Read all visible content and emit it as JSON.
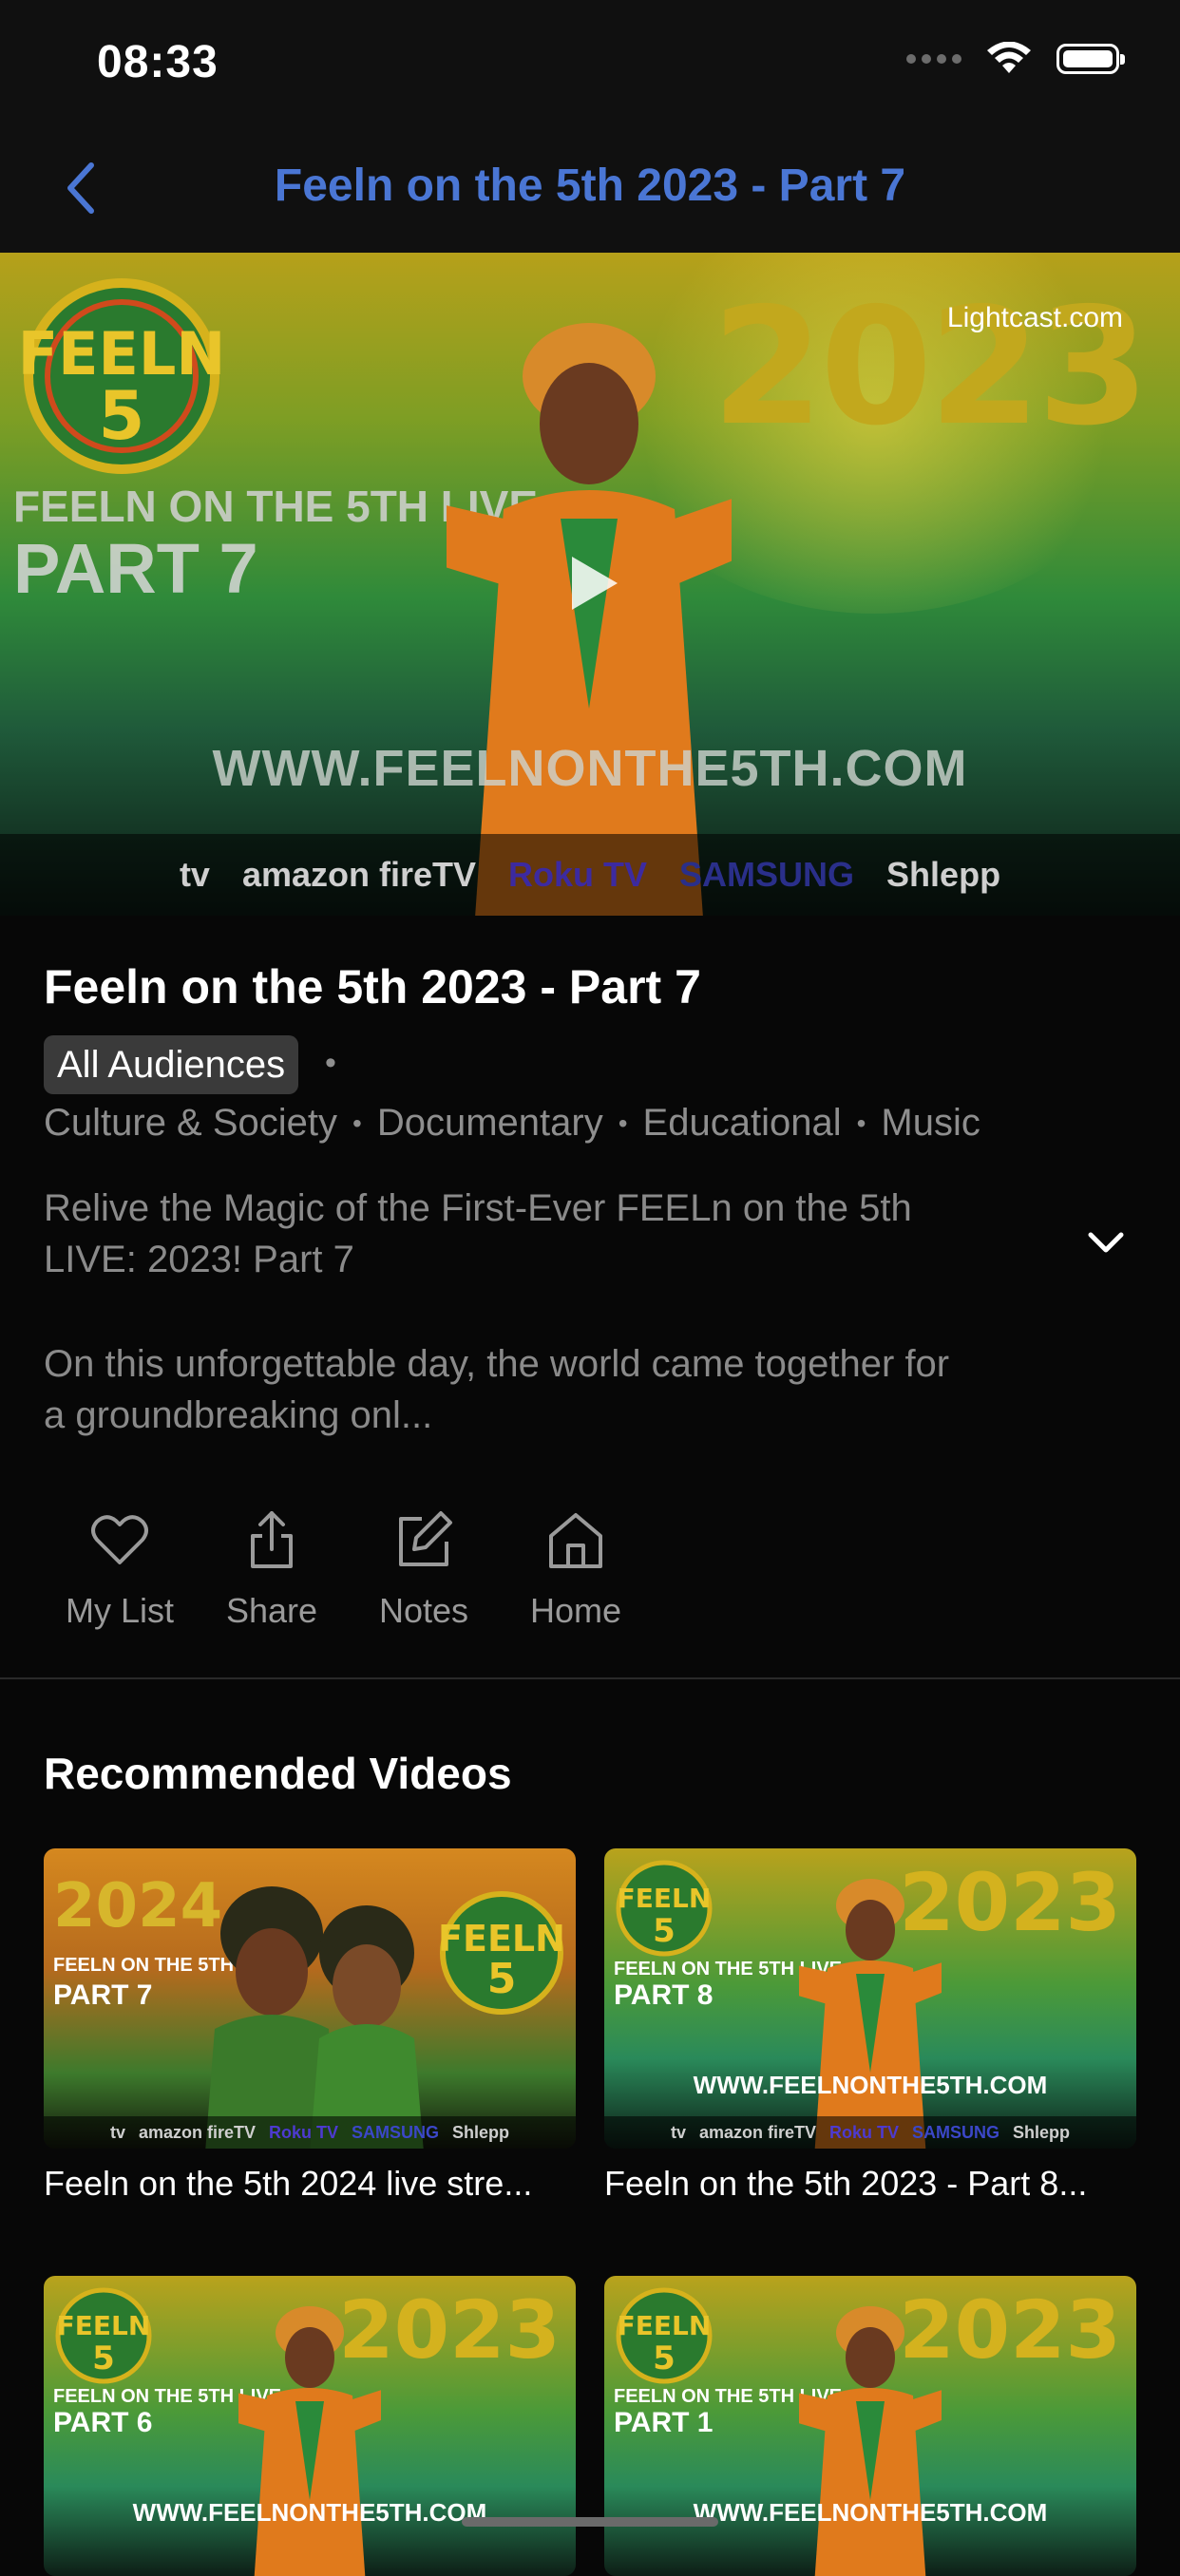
{
  "status_bar": {
    "time": "08:33"
  },
  "nav": {
    "title": "Feeln on the 5th 2023 -  Part 7"
  },
  "hero": {
    "site": "Lightcast.com",
    "year": "2023",
    "tag_line": "FEELN ON THE 5TH LIVE",
    "part": "PART 7",
    "url": "WWW.FEELNONTHE5TH.COM",
    "platforms": [
      "tv",
      "amazon fireTV",
      "Roku TV",
      "SAMSUNG",
      "Shlepp"
    ]
  },
  "video": {
    "title": "Feeln on the 5th 2023 -  Part 7",
    "rating": "All Audiences",
    "rating_dot": "•",
    "genres": [
      "Culture & Society",
      "Documentary",
      "Educational",
      "Music"
    ],
    "genre_sep": "•",
    "description_lines": [
      "Relive the Magic of the First-Ever FEELn on the 5th",
      "LIVE: 2023!  Part 7",
      "On this unforgettable day, the world came together for",
      "a groundbreaking onl..."
    ]
  },
  "actions": [
    {
      "label": "My List",
      "icon": "heart-icon"
    },
    {
      "label": "Share",
      "icon": "share-icon"
    },
    {
      "label": "Notes",
      "icon": "edit-icon"
    },
    {
      "label": "Home",
      "icon": "home-icon"
    }
  ],
  "recommended": {
    "heading": "Recommended Videos",
    "items": [
      {
        "caption": "Feeln on the 5th 2024 live stre...",
        "year": "2024",
        "tag": "FEELN ON THE 5TH LIVE",
        "part": "PART 7",
        "url": "",
        "platforms": [
          "tv",
          "amazon fireTV",
          "Roku TV",
          "SAMSUNG",
          "Shlepp"
        ]
      },
      {
        "caption": "Feeln on the 5th 2023 - Part 8...",
        "year": "2023",
        "tag": "FEELN ON THE 5TH LIVE",
        "part": "PART 8",
        "url": "WWW.FEELNONTHE5TH.COM",
        "platforms": [
          "tv",
          "amazon fireTV",
          "Roku TV",
          "SAMSUNG",
          "Shlepp"
        ]
      },
      {
        "caption": "",
        "year": "2023",
        "tag": "FEELN ON THE 5TH LIVE",
        "part": "PART 6",
        "url": "WWW.FEELNONTHE5TH.COM",
        "platforms": []
      },
      {
        "caption": "",
        "year": "2023",
        "tag": "FEELN ON THE 5TH LIVE",
        "part": "PART 1",
        "url": "WWW.FEELNONTHE5TH.COM",
        "platforms": []
      }
    ]
  },
  "colors": {
    "accent": "#4a76d4",
    "background": "#070707",
    "muted_text": "#8e8e8e"
  }
}
